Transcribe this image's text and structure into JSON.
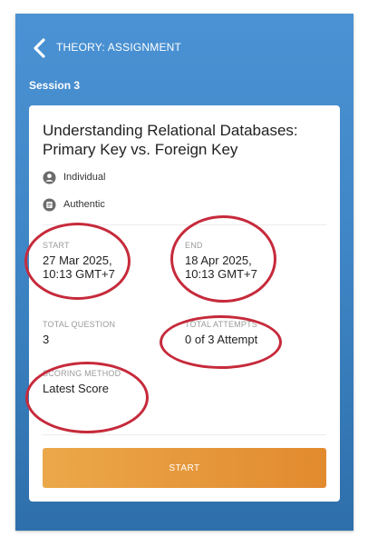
{
  "header": {
    "title": "THEORY: ASSIGNMENT",
    "back_icon": "chevron-left-icon"
  },
  "session": {
    "label": "Session 3"
  },
  "assignment": {
    "title": "Understanding Relational Databases: Primary Key vs. Foreign Key",
    "mode": "Individual",
    "mode_icon": "person-icon",
    "type": "Authentic",
    "type_icon": "document-icon"
  },
  "details": {
    "start_label": "START",
    "start_value": "27 Mar 2025,\n10:13 GMT+7",
    "end_label": "END",
    "end_value": "18 Apr 2025,\n10:13 GMT+7",
    "total_question_label": "TOTAL QUESTION",
    "total_question_value": "3",
    "total_attempts_label": "TOTAL ATTEMPTS",
    "total_attempts_value": "0 of 3 Attempt",
    "scoring_method_label": "SCORING METHOD",
    "scoring_method_value": "Latest Score"
  },
  "actions": {
    "start_label": "START"
  },
  "colors": {
    "header_gradient_top": "#4a92d3",
    "header_gradient_bottom": "#2e6fab",
    "button_orange": "#e28a2e",
    "annotation_red": "#c62a3b"
  }
}
